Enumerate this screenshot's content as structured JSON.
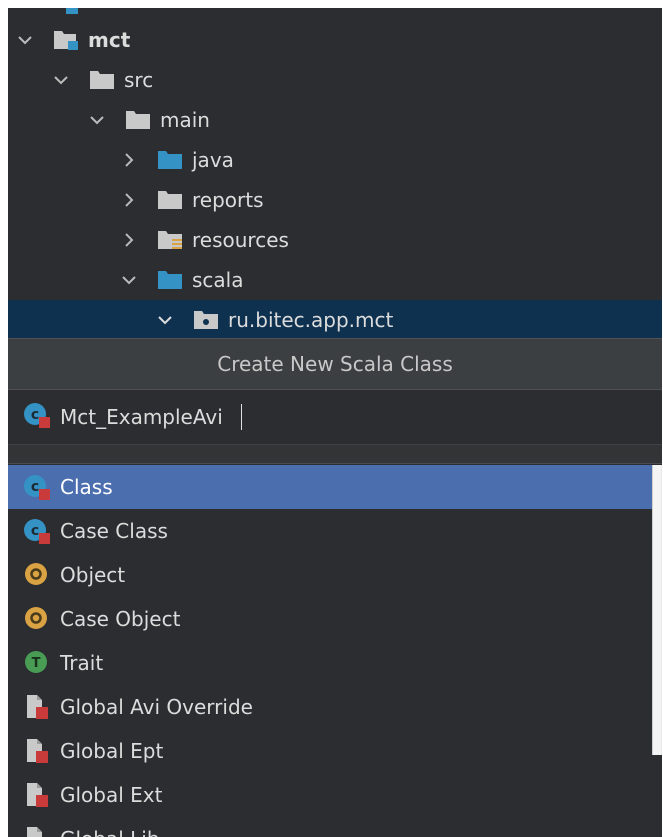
{
  "tree": {
    "items": [
      {
        "label": "mct",
        "chevron": "down",
        "icon": "module-folder-icon"
      },
      {
        "label": "src",
        "chevron": "down",
        "icon": "folder-icon"
      },
      {
        "label": "main",
        "chevron": "down",
        "icon": "folder-icon"
      },
      {
        "label": "java",
        "chevron": "right",
        "icon": "source-folder-icon"
      },
      {
        "label": "reports",
        "chevron": "right",
        "icon": "folder-icon"
      },
      {
        "label": "resources",
        "chevron": "right",
        "icon": "resources-folder-icon"
      },
      {
        "label": "scala",
        "chevron": "down",
        "icon": "source-folder-icon"
      },
      {
        "label": "ru.bitec.app.mct",
        "chevron": "down",
        "icon": "package-icon",
        "selected": true
      }
    ]
  },
  "dialog": {
    "title": "Create New Scala Class",
    "name_value": "Mct_ExampleAvi",
    "items": [
      {
        "label": "Class",
        "icon": "scala-class-icon",
        "selected": true
      },
      {
        "label": "Case Class",
        "icon": "scala-case-class-icon"
      },
      {
        "label": "Object",
        "icon": "scala-object-icon"
      },
      {
        "label": "Case Object",
        "icon": "scala-case-object-icon"
      },
      {
        "label": "Trait",
        "icon": "scala-trait-icon"
      },
      {
        "label": "Global Avi Override",
        "icon": "template-icon"
      },
      {
        "label": "Global Ept",
        "icon": "template-icon"
      },
      {
        "label": "Global Ext",
        "icon": "template-icon"
      },
      {
        "label": "Global Lib",
        "icon": "template-icon"
      }
    ]
  },
  "colors": {
    "background": "#2b2d30",
    "selection": "#4b6eaf",
    "tree_selection": "#0e3150",
    "folder": "#c9c9c9",
    "source_folder": "#3592c4",
    "class_icon": "#3592c4",
    "object_icon": "#d9a343",
    "trait_icon": "#499c54",
    "scala_red": "#c93b3b"
  }
}
